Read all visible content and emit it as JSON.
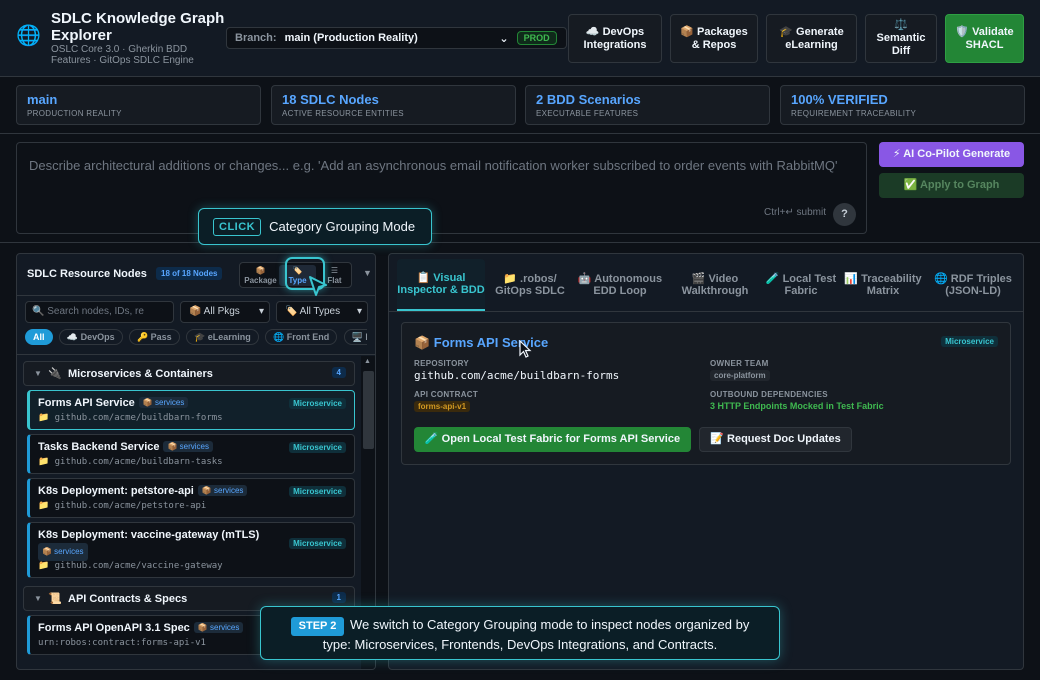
{
  "header": {
    "title": "SDLC Knowledge Graph Explorer",
    "subtitle": "OSLC Core 3.0 · Gherkin BDD Features · GitOps SDLC Engine",
    "branch_label": "Branch:",
    "branch_value": "main (Production Reality)",
    "branch_badge": "PROD",
    "buttons": {
      "devops": "☁️ DevOps Integrations",
      "packages": "📦 Packages & Repos",
      "elearning": "🎓 Generate eLearning",
      "semantic": "⚖️ Semantic Diff",
      "validate": "🛡️ Validate SHACL"
    }
  },
  "stats": [
    {
      "value": "main",
      "label": "PRODUCTION REALITY"
    },
    {
      "value": "18 SDLC Nodes",
      "label": "ACTIVE RESOURCE ENTITIES"
    },
    {
      "value": "2 BDD Scenarios",
      "label": "EXECUTABLE FEATURES"
    },
    {
      "value": "100% VERIFIED",
      "label": "REQUIREMENT TRACEABILITY"
    }
  ],
  "prompt": {
    "placeholder": "Describe architectural additions or changes... e.g. 'Add an asynchronous email notification worker subscribed to order events with RabbitMQ'",
    "submit_hint": "Ctrl+↵ submit",
    "help": "?",
    "ai_button": "⚡ AI Co-Pilot Generate",
    "apply_button": "✅ Apply to Graph"
  },
  "left_panel": {
    "title": "SDLC Resource Nodes",
    "count": "18 of 18 Nodes",
    "modes": [
      {
        "icon": "📦",
        "label": "Package"
      },
      {
        "icon": "🏷️",
        "label": "Type"
      },
      {
        "icon": "☰",
        "label": "Flat"
      }
    ],
    "search_placeholder": "Search nodes, IDs, re",
    "filter_pkgs": "📦 All Pkgs",
    "filter_types": "🏷️ All Types",
    "chips": [
      "All",
      "☁️ DevOps",
      "🔑 Pass",
      "🎓 eLearning",
      "🌐 Front End",
      "🖥️ Des"
    ],
    "groups": [
      {
        "icon": "🔌",
        "name": "Microservices & Containers",
        "count": "4",
        "nodes": [
          {
            "name": "Forms API Service",
            "pkg": "📦 services",
            "type": "Microservice",
            "repo": "📁 github.com/acme/buildbarn-forms"
          },
          {
            "name": "Tasks Backend Service",
            "pkg": "📦 services",
            "type": "Microservice",
            "repo": "📁 github.com/acme/buildbarn-tasks"
          },
          {
            "name": "K8s Deployment: petstore-api",
            "pkg": "📦 services",
            "type": "Microservice",
            "repo": "📁 github.com/acme/petstore-api"
          },
          {
            "name": "K8s Deployment: vaccine-gateway (mTLS)",
            "pkg": "📦 services",
            "type": "Microservice",
            "repo": "📁 github.com/acme/vaccine-gateway"
          }
        ]
      },
      {
        "icon": "📜",
        "name": "API Contracts & Specs",
        "count": "1",
        "nodes": [
          {
            "name": "Forms API OpenAPI 3.1 Spec",
            "pkg": "📦 services",
            "type": "",
            "repo": "urn:robos:contract:forms-api-v1"
          }
        ]
      }
    ]
  },
  "right_panel": {
    "tabs": [
      "📋 Visual Inspector & BDD",
      "📁 .robos/ GitOps SDLC",
      "🤖 Autonomous EDD Loop",
      "🎬 Video Walkthrough",
      "🧪 Local Test Fabric",
      "📊 Traceability Matrix",
      "🌐 RDF Triples (JSON-LD)"
    ],
    "detail": {
      "title": "📦 Forms API Service",
      "type": "Microservice",
      "repo_label": "REPOSITORY",
      "repo_value": "github.com/acme/buildbarn-forms",
      "team_label": "OWNER TEAM",
      "team_value": "core-platform",
      "api_label": "API CONTRACT",
      "api_value": "forms-api-v1",
      "deps_label": "OUTBOUND DEPENDENCIES",
      "deps_value": "3 HTTP Endpoints Mocked in Test Fabric",
      "open_button": "🧪 Open Local Test Fabric for Forms API Service",
      "doc_button": "📝 Request Doc Updates"
    }
  },
  "overlays": {
    "click_badge": "CLICK",
    "click_text": "Category Grouping Mode",
    "step_badge": "STEP 2",
    "step_text": "We switch to Category Grouping mode to inspect nodes organized by type: Microservices, Frontends, DevOps Integrations, and Contracts."
  },
  "colors": {
    "accent": "#39c5cf",
    "link": "#58a6ff",
    "success": "#238636",
    "purple": "#8957e5",
    "background": "#0d1117"
  }
}
